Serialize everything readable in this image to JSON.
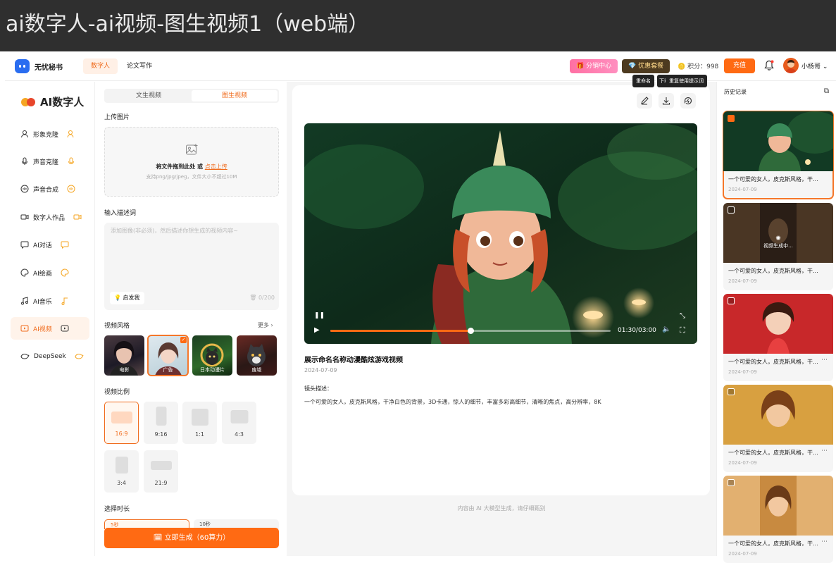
{
  "banner": {
    "title": "ai数字人-ai视频-图生视频1（web端）"
  },
  "topbar": {
    "app_name": "无忧秘书",
    "tabs": [
      {
        "label": "数字人",
        "active": true
      },
      {
        "label": "论文写作",
        "active": false
      }
    ],
    "distribution_center": "分销中心",
    "promo_package": "优惠套餐",
    "points": "积分：998",
    "recharge": "充值",
    "username": "小杨哥"
  },
  "sidebar": {
    "brand": "AI数字人",
    "items": [
      {
        "label": "形象克隆",
        "icon": "user-clone-icon"
      },
      {
        "label": "声音克隆",
        "icon": "microphone-icon"
      },
      {
        "label": "声音合成",
        "icon": "sound-wave-icon"
      },
      {
        "label": "数字人作品",
        "icon": "video-camera-icon"
      },
      {
        "label": "AI对话",
        "icon": "chat-bubble-icon"
      },
      {
        "label": "AI绘画",
        "icon": "palette-icon"
      },
      {
        "label": "AI音乐",
        "icon": "music-note-icon"
      },
      {
        "label": "AI视频",
        "icon": "video-icon",
        "active": true
      },
      {
        "label": "DeepSeek",
        "icon": "whale-icon"
      }
    ]
  },
  "panel": {
    "mode_tabs": [
      {
        "label": "文生视频",
        "active": false
      },
      {
        "label": "图生视频",
        "active": true
      }
    ],
    "upload_label": "上传图片",
    "upload_text": "将文件拖到此处 或 ",
    "upload_link": "点击上传",
    "upload_hint": "支持png/jpg/jpeg，文件大小不超过10M",
    "prompt_label": "输入描述词",
    "prompt_placeholder": "添加图像(非必须)，然后描述你想生成的视频内容~",
    "inspire": "启发我",
    "char_count": "0/200",
    "style_label": "视频风格",
    "style_more": "更多",
    "styles": [
      {
        "label": "电影",
        "selected": false
      },
      {
        "label": "广告",
        "selected": true
      },
      {
        "label": "日本动漫片",
        "selected": false
      },
      {
        "label": "废墟",
        "selected": false
      }
    ],
    "ratio_label": "视频比例",
    "ratios": [
      {
        "label": "16:9",
        "selected": true
      },
      {
        "label": "9:16",
        "selected": false
      },
      {
        "label": "1:1",
        "selected": false
      },
      {
        "label": "4:3",
        "selected": false
      },
      {
        "label": "3:4",
        "selected": false
      },
      {
        "label": "21:9",
        "selected": false
      }
    ],
    "duration_label": "选择时长",
    "durations": [
      {
        "label": "5秒",
        "selected": true
      },
      {
        "label": "10秒",
        "selected": false
      }
    ],
    "generate": "立即生成（60算力）"
  },
  "main": {
    "tooltips": {
      "rename": "重命名",
      "download": "下载",
      "reuse": "重复使用提示词"
    },
    "video_time": "01:30/03:00",
    "video_progress": 0.5,
    "title": "展示命名名称动漫酷炫游戏视频",
    "date": "2024-07-09",
    "desc_label": "镜头描述：",
    "desc": "一个可爱的女人，皮克斯风格，干净白色的背景，3D卡通，惊人的细节，丰富多彩高细节，清晰的焦点，高分辨率，8K",
    "footnote": "内容由 AI 大模型生成，请仔细甄别"
  },
  "history": {
    "title": "历史记录",
    "generating_label": "视频生成中...",
    "items": [
      {
        "caption": "一个可爱的女人，皮克斯风格，干...",
        "date": "2024-07-09",
        "selected": true,
        "generating": false
      },
      {
        "caption": "一个可爱的女人，皮克斯风格，干...",
        "date": "2024-07-09",
        "selected": false,
        "generating": true
      },
      {
        "caption": "一个可爱的女人，皮克斯风格，干...",
        "date": "2024-07-09",
        "selected": false,
        "generating": false
      },
      {
        "caption": "一个可爱的女人，皮克斯风格，干...",
        "date": "2024-07-09",
        "selected": false,
        "generating": false
      },
      {
        "caption": "一个可爱的女人，皮克斯风格，干...",
        "date": "2024-07-09",
        "selected": false,
        "generating": false
      }
    ]
  },
  "colors": {
    "accent": "#ff6a13",
    "accent_text": "#f06b1c"
  }
}
